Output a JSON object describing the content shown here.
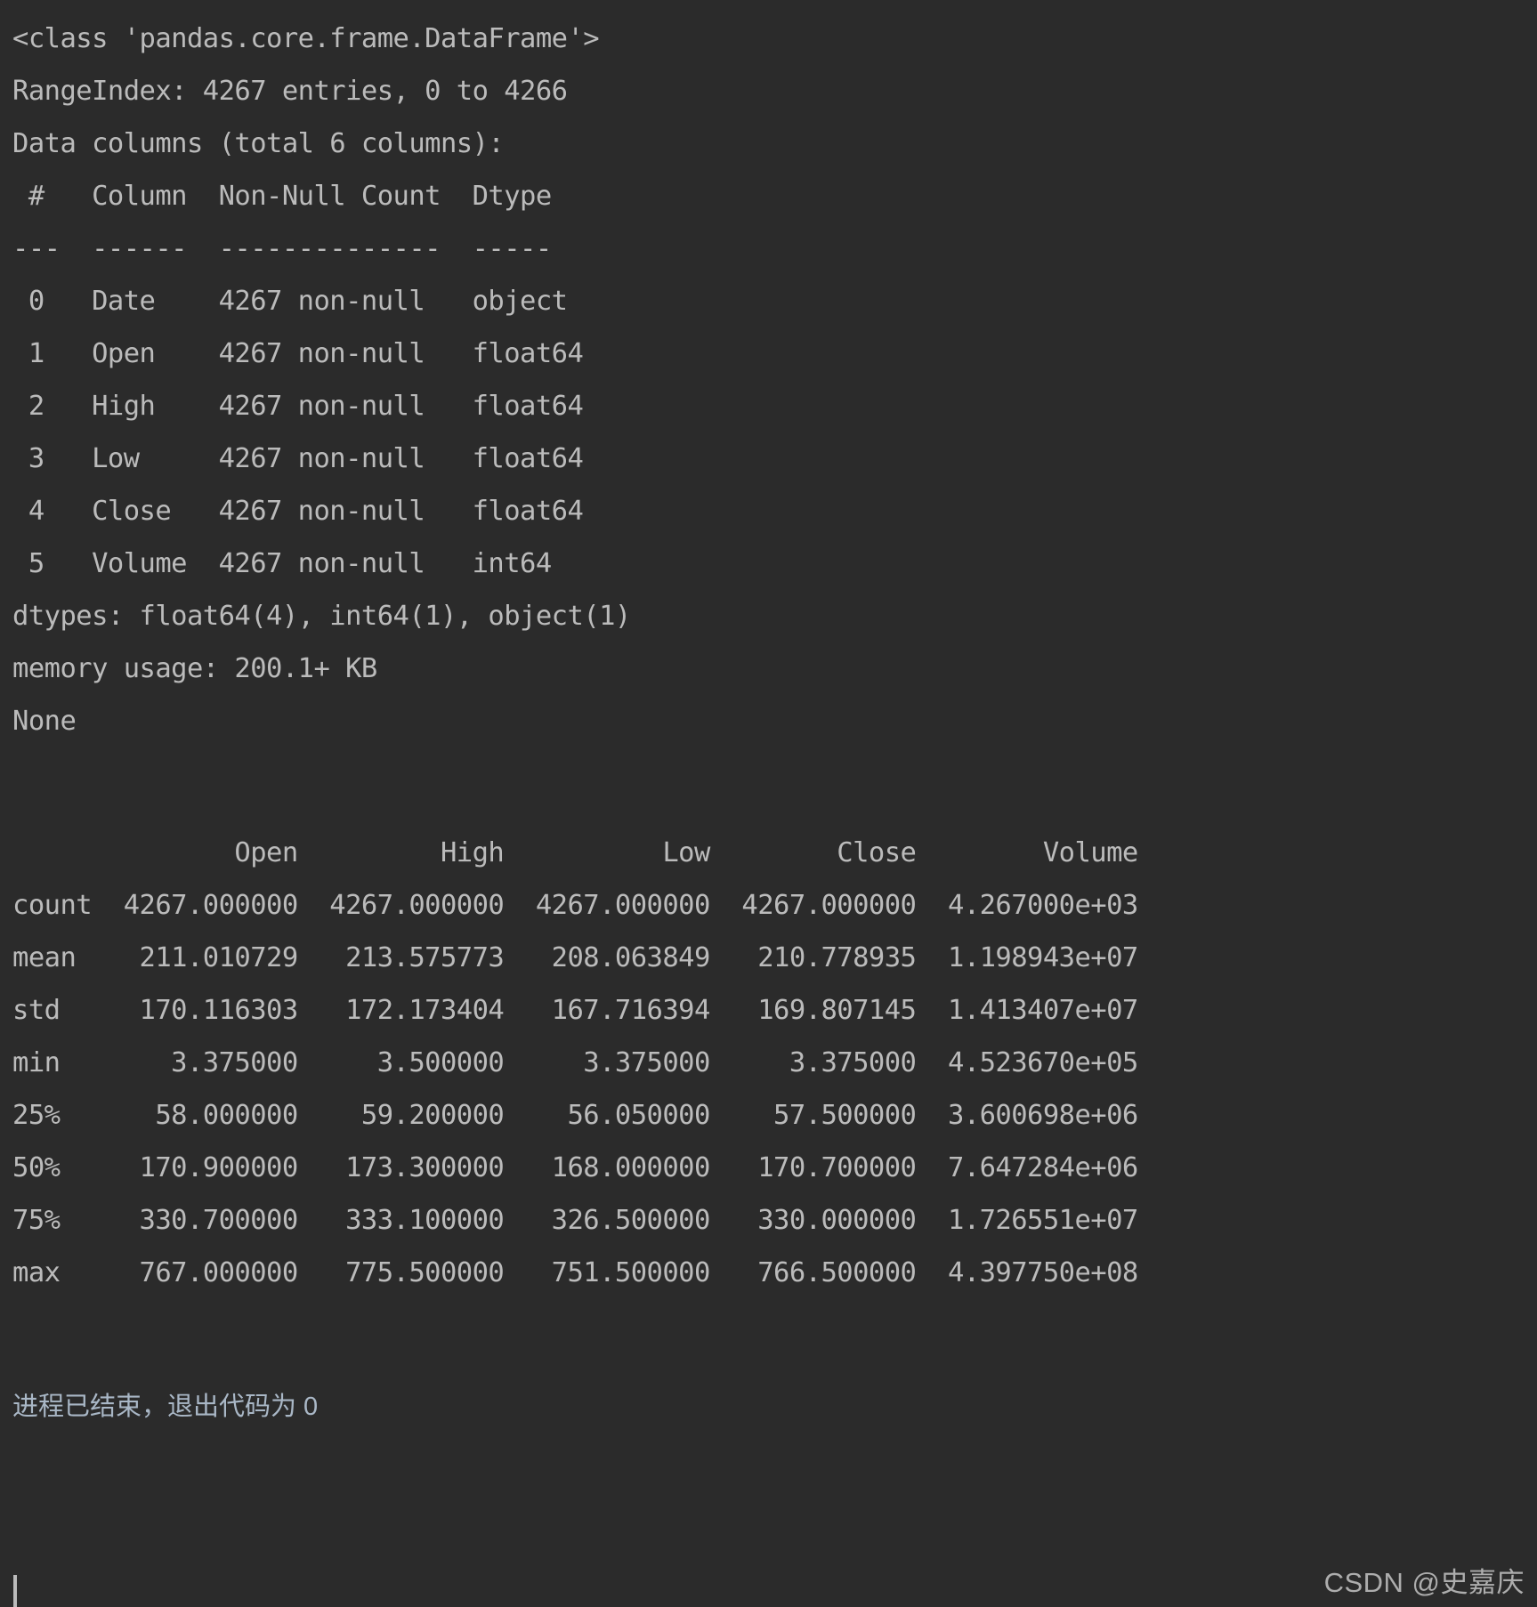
{
  "theme": {
    "background": "#2b2b2b",
    "foreground": "#bbbbbb",
    "exit_text_color": "#a9b7c6",
    "watermark_color": "#b9b9b9",
    "cursor_color": "#bbbbbb"
  },
  "console": {
    "info_block": {
      "class_line": "<class 'pandas.core.frame.DataFrame'>",
      "range_index": "RangeIndex: 4267 entries, 0 to 4266",
      "data_columns": "Data columns (total 6 columns):",
      "header": " #   Column  Non-Null Count  Dtype ",
      "separator": "---  ------  --------------  -----",
      "rows": [
        " 0   Date    4267 non-null   object ",
        " 1   Open    4267 non-null   float64",
        " 2   High    4267 non-null   float64",
        " 3   Low     4267 non-null   float64",
        " 4   Close   4267 non-null   float64",
        " 5   Volume  4267 non-null   int64  "
      ],
      "dtypes": "dtypes: float64(4), int64(1), object(1)",
      "memory_usage": "memory usage: 200.1+ KB",
      "none_line": "None"
    },
    "describe_block": {
      "header": "              Open         High          Low        Close        Volume",
      "rows": [
        "count  4267.000000  4267.000000  4267.000000  4267.000000  4.267000e+03",
        "mean    211.010729   213.575773   208.063849   210.778935  1.198943e+07",
        "std     170.116303   172.173404   167.716394   169.807145  1.413407e+07",
        "min       3.375000     3.500000     3.375000     3.375000  4.523670e+05",
        "25%      58.000000    59.200000    56.050000    57.500000  3.600698e+06",
        "50%     170.900000   173.300000   168.000000   170.700000  7.647284e+06",
        "75%     330.700000   333.100000   326.500000   330.000000  1.726551e+07",
        "max     767.000000   775.500000   751.500000   766.500000  4.397750e+08"
      ]
    },
    "exit_message": "进程已结束，退出代码为 0"
  },
  "watermark": {
    "text": "CSDN @史嘉庆"
  },
  "chart_data": {
    "type": "table",
    "title": "pandas DataFrame.describe() summary statistics",
    "index_name": "",
    "categories": [
      "count",
      "mean",
      "std",
      "min",
      "25%",
      "50%",
      "75%",
      "max"
    ],
    "columns": [
      "Open",
      "High",
      "Low",
      "Close",
      "Volume"
    ],
    "series": [
      {
        "name": "Open",
        "values": [
          4267.0,
          211.010729,
          170.116303,
          3.375,
          58.0,
          170.9,
          330.7,
          767.0
        ],
        "display": [
          "4267.000000",
          "211.010729",
          "170.116303",
          "3.375000",
          "58.000000",
          "170.900000",
          "330.700000",
          "767.000000"
        ]
      },
      {
        "name": "High",
        "values": [
          4267.0,
          213.575773,
          172.173404,
          3.5,
          59.2,
          173.3,
          333.1,
          775.5
        ],
        "display": [
          "4267.000000",
          "213.575773",
          "172.173404",
          "3.500000",
          "59.200000",
          "173.300000",
          "333.100000",
          "775.500000"
        ]
      },
      {
        "name": "Low",
        "values": [
          4267.0,
          208.063849,
          167.716394,
          3.375,
          56.05,
          168.0,
          326.5,
          751.5
        ],
        "display": [
          "4267.000000",
          "208.063849",
          "167.716394",
          "3.375000",
          "56.050000",
          "168.000000",
          "326.500000",
          "751.500000"
        ]
      },
      {
        "name": "Close",
        "values": [
          4267.0,
          210.778935,
          169.807145,
          3.375,
          57.5,
          170.7,
          330.0,
          766.5
        ],
        "display": [
          "4267.000000",
          "210.778935",
          "169.807145",
          "3.375000",
          "57.500000",
          "170.700000",
          "330.000000",
          "766.500000"
        ]
      },
      {
        "name": "Volume",
        "values": [
          4267.0,
          11989430.0,
          14134070.0,
          452367.0,
          3600698.0,
          7647284.0,
          17265510.0,
          439775000.0
        ],
        "display": [
          "4.267000e+03",
          "1.198943e+07",
          "1.413407e+07",
          "4.523670e+05",
          "3.600698e+06",
          "7.647284e+06",
          "1.726551e+07",
          "4.397750e+08"
        ]
      }
    ],
    "schema": {
      "total_entries": 4267,
      "index_range": "0 to 4266",
      "total_columns": 6,
      "fields": [
        {
          "index": 0,
          "name": "Date",
          "non_null": "4267 non-null",
          "dtype": "object"
        },
        {
          "index": 1,
          "name": "Open",
          "non_null": "4267 non-null",
          "dtype": "float64"
        },
        {
          "index": 2,
          "name": "High",
          "non_null": "4267 non-null",
          "dtype": "float64"
        },
        {
          "index": 3,
          "name": "Low",
          "non_null": "4267 non-null",
          "dtype": "float64"
        },
        {
          "index": 4,
          "name": "Close",
          "non_null": "4267 non-null",
          "dtype": "float64"
        },
        {
          "index": 5,
          "name": "Volume",
          "non_null": "4267 non-null",
          "dtype": "int64"
        }
      ],
      "dtypes_summary": "float64(4), int64(1), object(1)",
      "memory_usage": "200.1+ KB"
    }
  }
}
